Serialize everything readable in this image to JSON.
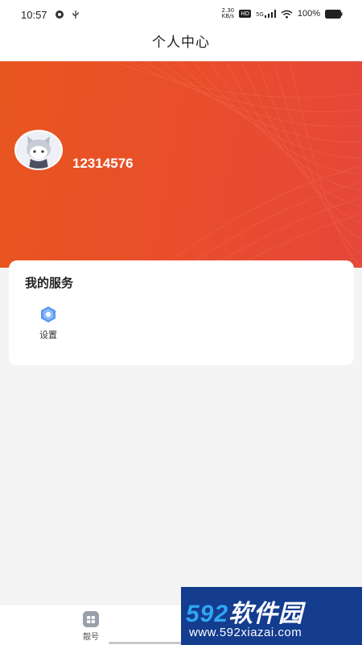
{
  "status_bar": {
    "time": "10:57",
    "net_speed_value": "2.30",
    "net_speed_unit": "KB/s",
    "hd_label": "HD",
    "network": "5G",
    "battery_pct": "100%"
  },
  "header": {
    "title": "个人中心"
  },
  "profile": {
    "user_id": "12314576"
  },
  "services": {
    "title": "我的服务",
    "items": [
      {
        "label": "设置",
        "icon": "settings-hex-icon"
      }
    ]
  },
  "tabbar": {
    "tabs": [
      {
        "label": "靓号",
        "icon": "grid-box-icon"
      }
    ]
  },
  "watermark": {
    "brand_num": "592",
    "brand_text": "软件园",
    "url": "www.592xiazai.com"
  },
  "colors": {
    "banner_start": "#e8561f",
    "banner_end": "#e5473a",
    "settings_icon": "#5b9bf3",
    "watermark_bg": "#143c8f"
  }
}
